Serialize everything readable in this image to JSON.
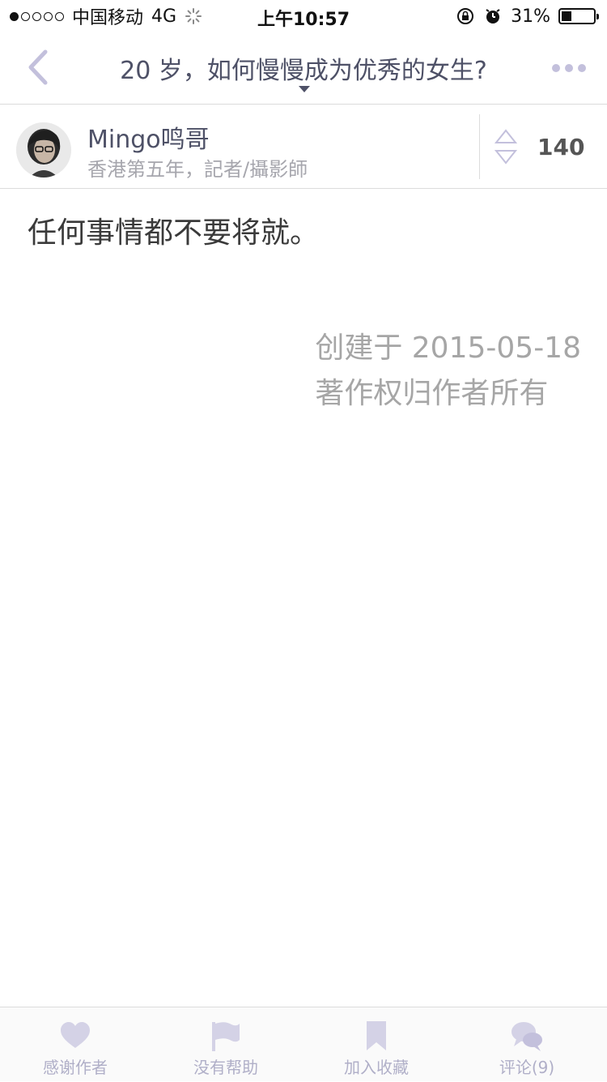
{
  "status_bar": {
    "carrier": "中国移动",
    "network": "4G",
    "time": "上午10:57",
    "battery_percent": "31%",
    "battery_level": 0.31
  },
  "nav": {
    "title": "20 岁，如何慢慢成为优秀的女生?",
    "back_icon": "chevron-left-icon",
    "more_icon": "more-dots-icon"
  },
  "author": {
    "name": "Mingo鸣哥",
    "bio": "香港第五年，記者/攝影師",
    "votes": "140"
  },
  "answer": {
    "text": "任何事情都不要将就。",
    "created": "创建于 2015-05-18",
    "copyright": "著作权归作者所有"
  },
  "tabs": [
    {
      "label": "感谢作者",
      "icon": "heart-icon"
    },
    {
      "label": "没有帮助",
      "icon": "flag-icon"
    },
    {
      "label": "加入收藏",
      "icon": "bookmark-icon"
    },
    {
      "label": "评论(9)",
      "icon": "comment-icon"
    }
  ],
  "colors": {
    "accent": "#4e5167",
    "icon_light": "#c3c0dc",
    "muted": "#a6a6a6"
  }
}
